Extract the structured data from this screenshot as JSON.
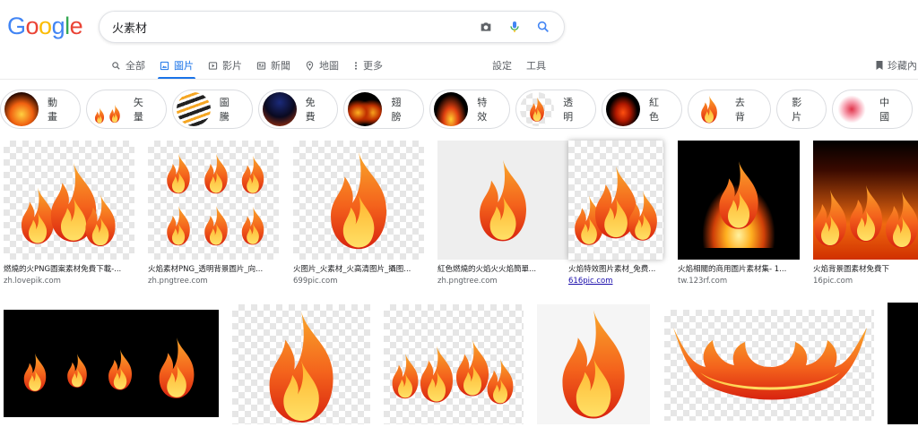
{
  "logo": {
    "letters": [
      "G",
      "o",
      "o",
      "g",
      "l",
      "e"
    ],
    "colors": [
      "#4285F4",
      "#EA4335",
      "#FBBC05",
      "#4285F4",
      "#34A853",
      "#EA4335"
    ]
  },
  "search": {
    "query": "火素材",
    "icons": [
      "camera-icon",
      "mic-icon",
      "search-icon"
    ]
  },
  "tabs": [
    {
      "label": "全部",
      "icon": "search-icon",
      "active": false
    },
    {
      "label": "圖片",
      "icon": "image-icon",
      "active": true
    },
    {
      "label": "影片",
      "icon": "video-icon",
      "active": false
    },
    {
      "label": "新聞",
      "icon": "news-icon",
      "active": false
    },
    {
      "label": "地圖",
      "icon": "map-pin-icon",
      "active": false
    },
    {
      "label": "更多",
      "icon": "more-icon",
      "active": false
    }
  ],
  "tools": {
    "settings": "設定",
    "tools": "工具",
    "collections": "珍藏內"
  },
  "chips": [
    {
      "label": "動畫"
    },
    {
      "label": "矢量"
    },
    {
      "label": "圖騰"
    },
    {
      "label": "免費"
    },
    {
      "label": "翅膀"
    },
    {
      "label": "特效"
    },
    {
      "label": "透明"
    },
    {
      "label": "紅色"
    },
    {
      "label": "去 背"
    },
    {
      "label": "影片"
    },
    {
      "label": "中國"
    }
  ],
  "results": [
    {
      "caption": "燃燒的火PNG圖案素材免費下載-...",
      "source": "zh.lovepik.com"
    },
    {
      "caption": "火焰素材PNG_透明背景圖片_向...",
      "source": "zh.pngtree.com"
    },
    {
      "caption": "火图片_火素材_火高清图片_攝图...",
      "source": "699pic.com"
    },
    {
      "caption": "紅色燃燒的火焰火火焰簡單...",
      "source": "zh.pngtree.com"
    },
    {
      "caption": "火焰特效图片素材_免费...",
      "source": "616pic.com"
    },
    {
      "caption": "火焰相關的商用圖片素材集- 1...",
      "source": "tw.123rf.com"
    },
    {
      "caption": "火焰背景圖素材免費下",
      "source": "16pic.com"
    }
  ],
  "colors": {
    "accent": "#1a73e8",
    "flame_dark": "#e8401c",
    "flame_mid": "#f7931e",
    "flame_light": "#ffd33d"
  }
}
